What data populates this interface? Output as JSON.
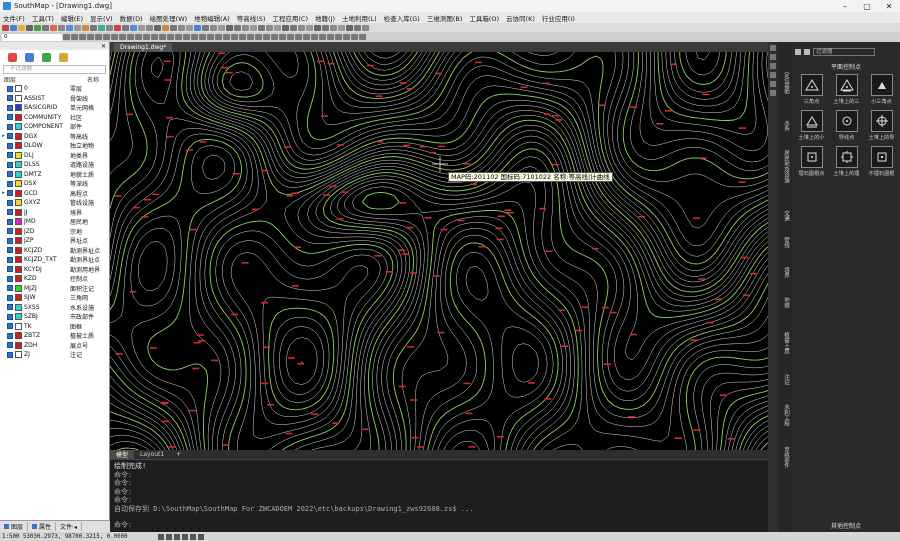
{
  "window": {
    "app": "SouthMap",
    "title": "SouthMap - [Drawing1.dwg]"
  },
  "menu": [
    "文件(F)",
    "工具(T)",
    "编辑(E)",
    "显示(V)",
    "数据(D)",
    "绘图处理(W)",
    "地物编辑(A)",
    "等高线(S)",
    "工程应用(C)",
    "地籍(J)",
    "土地利用(L)",
    "检查入库(G)",
    "三维测图(B)",
    "工具箱(O)",
    "云协同(K)",
    "行业应用(I)"
  ],
  "toolbar": {
    "layer_value": "0"
  },
  "layer_panel": {
    "search_placeholder": "不过滤器",
    "col_layer": "图层",
    "col_name": "名称",
    "rows": [
      {
        "id": "0",
        "desc": "零层",
        "color": "#ffffff",
        "arrow": ""
      },
      {
        "id": "ASSIST",
        "desc": "骨架线",
        "color": "#ffffff",
        "arrow": ""
      },
      {
        "id": "BASICGRID",
        "desc": "单元网格",
        "color": "#1c3fd1",
        "arrow": ""
      },
      {
        "id": "COMMUNITY",
        "desc": "社区",
        "color": "#d21b1b",
        "arrow": ""
      },
      {
        "id": "COMPONENT",
        "desc": "部件",
        "color": "#26d4d4",
        "arrow": ""
      },
      {
        "id": "DGX",
        "desc": "等高线",
        "color": "#d21b1b",
        "arrow": "▸"
      },
      {
        "id": "DLDW",
        "desc": "独立地物",
        "color": "#d21b1b",
        "arrow": ""
      },
      {
        "id": "DLJ",
        "desc": "地类界",
        "color": "#e6e11a",
        "arrow": ""
      },
      {
        "id": "DLSS",
        "desc": "道路设施",
        "color": "#26d4d4",
        "arrow": ""
      },
      {
        "id": "DMTZ",
        "desc": "地貌土质",
        "color": "#26d4d4",
        "arrow": ""
      },
      {
        "id": "DSX",
        "desc": "等深线",
        "color": "#e6e11a",
        "arrow": ""
      },
      {
        "id": "GCD",
        "desc": "高程点",
        "color": "#d21b1b",
        "arrow": "▸"
      },
      {
        "id": "GXYZ",
        "desc": "管线设施",
        "color": "#e6e11a",
        "arrow": ""
      },
      {
        "id": "JJ",
        "desc": "境界",
        "color": "#d21b1b",
        "arrow": ""
      },
      {
        "id": "JMD",
        "desc": "居民地",
        "color": "#e01bd6",
        "arrow": ""
      },
      {
        "id": "JZD",
        "desc": "宗地",
        "color": "#d21b1b",
        "arrow": ""
      },
      {
        "id": "JZP",
        "desc": "界址点",
        "color": "#d21b1b",
        "arrow": ""
      },
      {
        "id": "KCJZD",
        "desc": "勘测界址点",
        "color": "#d21b1b",
        "arrow": ""
      },
      {
        "id": "KCJZD_TXT",
        "desc": "勘测界址点",
        "color": "#d21b1b",
        "arrow": ""
      },
      {
        "id": "KCYDJ",
        "desc": "勘测用地界",
        "color": "#d21b1b",
        "arrow": ""
      },
      {
        "id": "KZD",
        "desc": "控制点",
        "color": "#d21b1b",
        "arrow": ""
      },
      {
        "id": "MJZJ",
        "desc": "面积注记",
        "color": "#2bd42b",
        "arrow": ""
      },
      {
        "id": "SJW",
        "desc": "三角网",
        "color": "#d21b1b",
        "arrow": ""
      },
      {
        "id": "SXSS",
        "desc": "水系设施",
        "color": "#26d4d4",
        "arrow": ""
      },
      {
        "id": "SZBJ",
        "desc": "市政部件",
        "color": "#26d4d4",
        "arrow": ""
      },
      {
        "id": "TK",
        "desc": "图框",
        "color": "#ffffff",
        "arrow": ""
      },
      {
        "id": "ZBTZ",
        "desc": "植被土质",
        "color": "#d21b1b",
        "arrow": ""
      },
      {
        "id": "ZDH",
        "desc": "展点号",
        "color": "#d21b1b",
        "arrow": ""
      },
      {
        "id": "ZJ",
        "desc": "注记",
        "color": "#ffffff",
        "arrow": ""
      }
    ],
    "tabs": [
      "图层",
      "属性",
      "文件·◂"
    ]
  },
  "doc_tab": "Drawing1.dwg*",
  "tooltip": "MAP码:201102 国标码:7101022 名称:等高线|计曲线",
  "layout_tabs": [
    "模型",
    "Layout1",
    "+"
  ],
  "command_lines": [
    "绘制完成!",
    "命令:",
    "命令:",
    "命令:",
    "命令:",
    "自动保存到 D:\\SouthMap\\SouthMap For ZWCADOEM 2022\\etc\\backups\\Drawing1_zws92608.zs$ ..."
  ],
  "command_prompt": "命令:",
  "vertical_tabs": [
    "定位基础",
    "水系",
    "居民地及设施",
    "交通",
    "管线",
    "境界",
    "地貌",
    "植被土质",
    "注记",
    "水利工程",
    "市政部件"
  ],
  "control_panel": {
    "filter": "过滤器",
    "section_title": "平面控制点",
    "items": [
      "三角点",
      "土堆上的三",
      "小三角点",
      "土堆上的小",
      "导线点",
      "土堆上的导",
      "埋石图根点",
      "土堆上的埋",
      "不埋石图根"
    ],
    "footer": "其他控制点"
  },
  "status": {
    "coords": "1:500 53030.2973, 98700.3215, 0.0000"
  }
}
